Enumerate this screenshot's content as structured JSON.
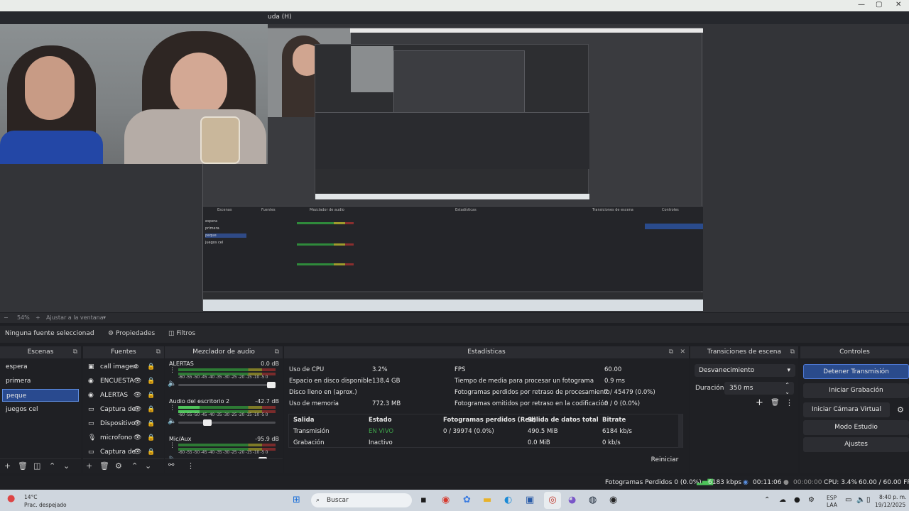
{
  "menubar": {
    "partial_menu": "uda (H)"
  },
  "preview": {
    "zoom": "54%",
    "fit_label": "Ajustar a la ventana"
  },
  "source_toolbar": {
    "no_source": "Ninguna fuente seleccionad",
    "properties": "Propiedades",
    "filters": "Filtros"
  },
  "scenes": {
    "title": "Escenas",
    "items": [
      "espera",
      "primera",
      "peque",
      "juegos cel"
    ],
    "selected_index": 2
  },
  "sources": {
    "title": "Fuentes",
    "items": [
      {
        "icon": "image-icon",
        "name": "call imagen",
        "hidden": true
      },
      {
        "icon": "browser-icon",
        "name": "ENCUESTA",
        "hidden": false
      },
      {
        "icon": "browser-icon",
        "name": "ALERTAS",
        "hidden": false
      },
      {
        "icon": "display-icon",
        "name": "Captura de",
        "hidden": false
      },
      {
        "icon": "display-icon",
        "name": "Dispositivo",
        "hidden": false
      },
      {
        "icon": "microphone-icon",
        "name": "microfono",
        "hidden": false
      },
      {
        "icon": "display-icon",
        "name": "Captura de",
        "hidden": false
      }
    ]
  },
  "mixer": {
    "title": "Mezclador de audio",
    "ticks": "-60 -55 -50 -45 -40 -35 -30 -25 -20 -15 -10 -5  0",
    "tracks": [
      {
        "name": "ALERTAS",
        "db": "0.0 dB",
        "level": 0,
        "fader": 1.0
      },
      {
        "name": "Audio del escritorio 2",
        "db": "-42.7 dB",
        "level": 0.22,
        "fader": 0.28
      },
      {
        "name": "Mic/Aux",
        "db": "-95.9 dB",
        "level": 0,
        "fader": 0.9
      }
    ]
  },
  "stats": {
    "title": "Estadísticas",
    "left": [
      {
        "label": "Uso de CPU",
        "value": "3.2%"
      },
      {
        "label": "Espacio en disco disponible",
        "value": "138.4 GB"
      },
      {
        "label": "Disco lleno en (aprox.)",
        "value": ""
      },
      {
        "label": "Uso de memoria",
        "value": "772.3 MB"
      }
    ],
    "right": [
      {
        "label": "FPS",
        "value": "60.00"
      },
      {
        "label": "Tiempo de media para procesar un fotograma",
        "value": "0.9 ms"
      },
      {
        "label": "Fotogramas perdidos por retraso de procesamiento",
        "value": "7 / 45479 (0.0%)"
      },
      {
        "label": "Fotogramas omitidos por retraso en la codificación",
        "value": "0 / 0 (0.0%)"
      }
    ],
    "table_headers": [
      "Salida",
      "Estado",
      "Fotogramas perdidos (Red)",
      "Salida de datos total",
      "Bitrate"
    ],
    "table_rows": [
      [
        "Transmisión",
        "EN VIVO",
        "0 / 39974 (0.0%)",
        "490.5 MiB",
        "6184 kb/s"
      ],
      [
        "Grabación",
        "Inactivo",
        "",
        "0.0 MiB",
        "0 kb/s"
      ]
    ],
    "reset": "Reiniciar"
  },
  "transitions": {
    "title": "Transiciones de escena",
    "selected": "Desvanecimiento",
    "duration_label": "Duración",
    "duration": "350 ms"
  },
  "controls": {
    "title": "Controles",
    "stop_stream": "Detener Transmisión",
    "start_recording": "Iniciar Grabación",
    "start_virtual_cam": "Iniciar Cámara Virtual",
    "studio_mode": "Modo Estudio",
    "settings": "Ajustes"
  },
  "statusbar": {
    "dropped": "Fotogramas Perdidos 0 (0.0%)",
    "kbps": "6183 kbps",
    "stream_time": "00:11:06",
    "rec_time": "00:00:00",
    "cpu": "CPU: 3.4%",
    "fps": "60.00 / 60.00 FPS"
  },
  "taskbar": {
    "weather_temp": "14°C",
    "weather_desc": "Prac. despejado",
    "search": "Buscar",
    "lang1": "ESP",
    "lang2": "LAA",
    "time": "8:40 p. m.",
    "date": "19/12/2025"
  },
  "colors": {
    "accent": "#2a4b8c",
    "live": "#3ea34a",
    "background": "#1f2024"
  }
}
